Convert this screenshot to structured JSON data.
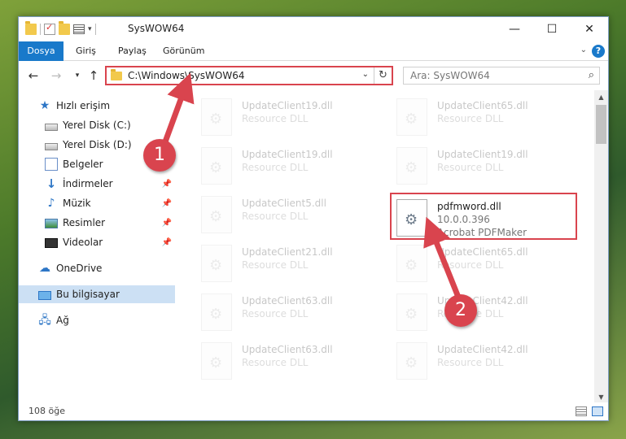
{
  "window": {
    "title": "SysWOW64"
  },
  "title_buttons": {
    "minimize": "—",
    "maximize": "☐",
    "close": "✕"
  },
  "ribbon": {
    "tabs": [
      "Dosya",
      "Giriş",
      "Paylaş",
      "Görünüm"
    ],
    "help": "?"
  },
  "address": {
    "path": "C:\\Windows\\SysWOW64"
  },
  "search": {
    "placeholder": "Ara: SysWOW64"
  },
  "sidebar": {
    "items": [
      {
        "label": "Hızlı erişim",
        "icon": "star-icon"
      },
      {
        "label": "Yerel Disk (C:)",
        "icon": "drive-icon"
      },
      {
        "label": "Yerel Disk (D:)",
        "icon": "drive-icon"
      },
      {
        "label": "Belgeler",
        "icon": "documents-icon"
      },
      {
        "label": "İndirmeler",
        "icon": "downloads-icon"
      },
      {
        "label": "Müzik",
        "icon": "music-icon"
      },
      {
        "label": "Resimler",
        "icon": "pictures-icon"
      },
      {
        "label": "Videolar",
        "icon": "videos-icon"
      },
      {
        "label": "OneDrive",
        "icon": "cloud-icon"
      },
      {
        "label": "Bu bilgisayar",
        "icon": "computer-icon"
      },
      {
        "label": "Ağ",
        "icon": "network-icon"
      }
    ]
  },
  "files": {
    "left": [
      {
        "name": "UpdateClient19.dll",
        "type": "Resource DLL"
      },
      {
        "name": "UpdateClient19.dll",
        "type": "Resource DLL"
      },
      {
        "name": "UpdateClient5.dll",
        "type": "Resource DLL"
      },
      {
        "name": "UpdateClient21.dll",
        "type": "Resource DLL"
      },
      {
        "name": "UpdateClient63.dll",
        "type": "Resource DLL"
      },
      {
        "name": "UpdateClient63.dll",
        "type": "Resource DLL"
      }
    ],
    "right": [
      {
        "name": "UpdateClient65.dll",
        "type": "Resource DLL"
      },
      {
        "name": "UpdateClient19.dll",
        "type": "Resource DLL"
      },
      {
        "name": "UpdateClient65.dll",
        "type": "Resource DLL"
      },
      {
        "name": "UpdateClient42.dll",
        "type": "Resource DLL"
      },
      {
        "name": "UpdateClient42.dll",
        "type": "Resource DLL"
      }
    ],
    "highlighted": {
      "name": "pdfmword.dll",
      "version": "10.0.0.396",
      "description": "Acrobat PDFMaker"
    }
  },
  "status": {
    "count": "108 öğe"
  },
  "annotations": {
    "step1": "1",
    "step2": "2",
    "color": "#d9444e"
  }
}
